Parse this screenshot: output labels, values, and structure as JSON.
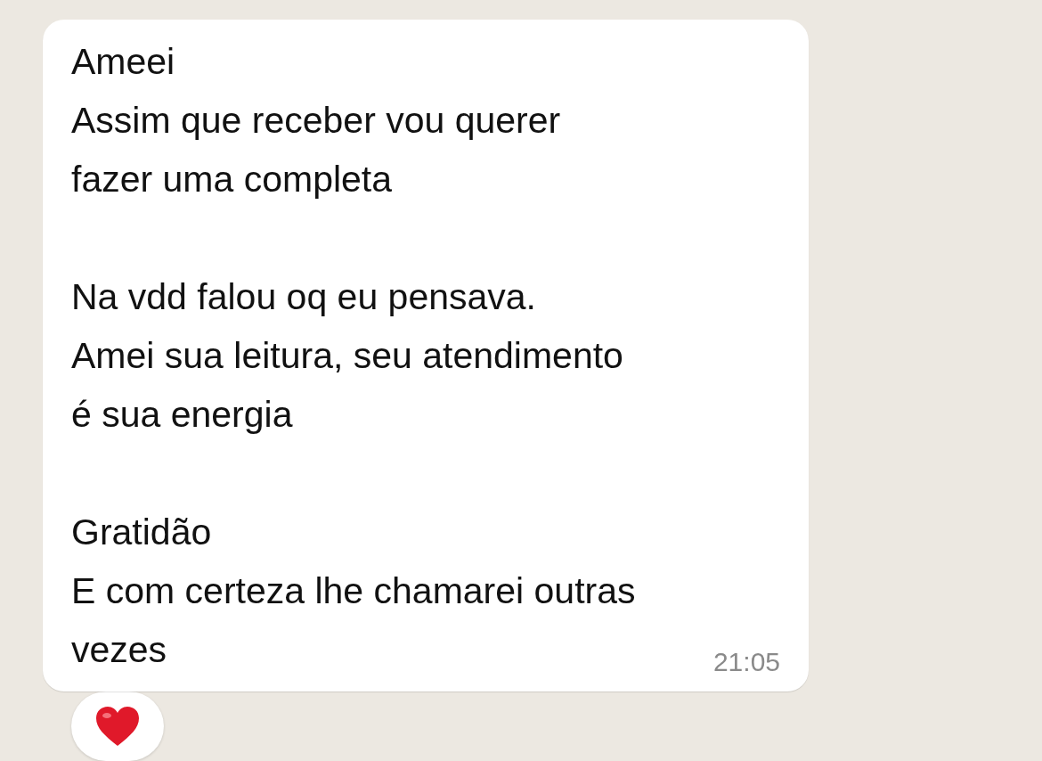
{
  "message": {
    "text": "Ameei\nAssim que receber vou querer\nfazer uma completa\n\nNa vdd falou oq eu pensava.\nAmei sua leitura, seu atendimento\né sua energia\n\nGratidão\nE com certeza lhe chamarei outras\nvezes",
    "time": "21:05",
    "reactions": [
      {
        "kind": "heart"
      }
    ]
  }
}
